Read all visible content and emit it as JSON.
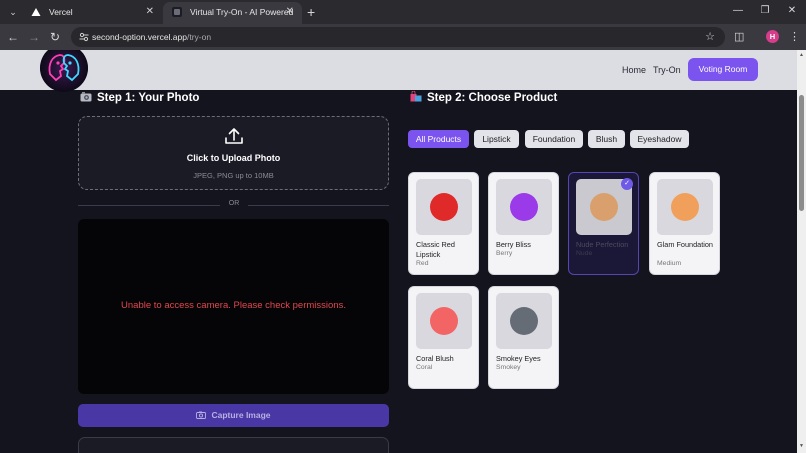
{
  "browser": {
    "tabs": [
      {
        "title": "Vercel",
        "active": false
      },
      {
        "title": "Virtual Try-On - AI Powered",
        "active": true
      }
    ],
    "url_host": "second-option.vercel.app",
    "url_path": "/try-on",
    "profile_initial": "H"
  },
  "header": {
    "nav": [
      "Home",
      "Try-On"
    ],
    "cta_label": "Voting Room"
  },
  "step1": {
    "title": "Step 1: Your Photo",
    "upload_title": "Click to Upload Photo",
    "upload_subtitle": "JPEG, PNG up to 10MB",
    "divider_text": "OR",
    "camera_error": "Unable to access camera. Please check permissions.",
    "capture_label": "Capture Image"
  },
  "step2": {
    "title": "Step 2: Choose Product",
    "filters": [
      {
        "label": "All Products",
        "active": true
      },
      {
        "label": "Lipstick",
        "active": false
      },
      {
        "label": "Foundation",
        "active": false
      },
      {
        "label": "Blush",
        "active": false
      },
      {
        "label": "Eyeshadow",
        "active": false
      }
    ],
    "products": [
      {
        "name": "Classic Red Lipstick",
        "shade": "Red",
        "color": "#e02a2a",
        "selected": false
      },
      {
        "name": "Berry Bliss",
        "shade": "Berry",
        "color": "#9a3ae8",
        "selected": false
      },
      {
        "name": "Nude Perfection",
        "shade": "Nude",
        "color": "#d9a06e",
        "selected": true
      },
      {
        "name": "Glam Foundation",
        "shade": "Medium",
        "color": "#f0a05a",
        "selected": false
      },
      {
        "name": "Coral Blush",
        "shade": "Coral",
        "color": "#f36464",
        "selected": false
      },
      {
        "name": "Smokey Eyes",
        "shade": "Smokey",
        "color": "#656c76",
        "selected": false
      }
    ]
  },
  "colors": {
    "accent": "#7b53ee",
    "capture_button": "#4a37a6",
    "error_text": "#e0484e"
  }
}
